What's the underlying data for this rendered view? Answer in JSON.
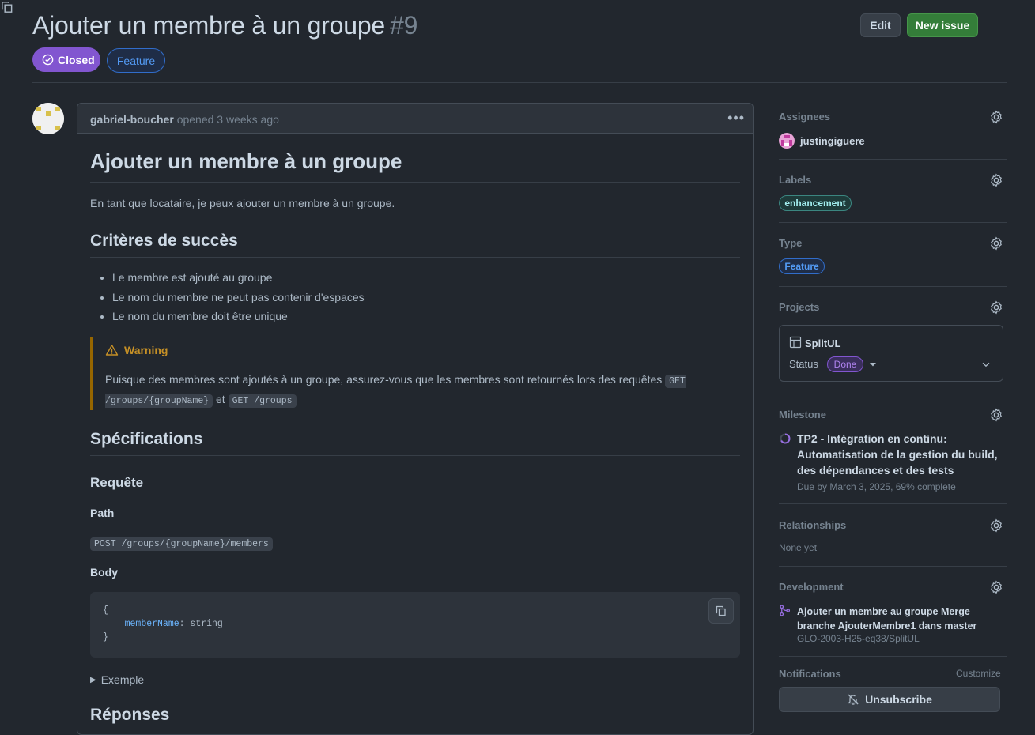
{
  "issue": {
    "title": "Ajouter un membre à un groupe",
    "number": "#9",
    "state": "Closed",
    "type_badge": "Feature"
  },
  "toolbar": {
    "edit_label": "Edit",
    "new_issue_label": "New issue"
  },
  "comment": {
    "author": "gabriel-boucher",
    "opened_text": "opened 3 weeks ago",
    "heading": "Ajouter un membre à un groupe",
    "intro": "En tant que locataire, je peux ajouter un membre à un groupe.",
    "success_heading": "Critères de succès",
    "criteria": [
      "Le membre est ajouté au groupe",
      "Le nom du membre ne peut pas contenir d'espaces",
      "Le nom du membre doit être unique"
    ],
    "warning": {
      "title": "Warning",
      "text_before": "Puisque des membres sont ajoutés à un groupe, assurez-vous que les membres sont retournés lors des requêtes",
      "code1": "GET /groups/{groupName}",
      "between": "et",
      "code2": "GET /groups"
    },
    "spec_heading": "Spécifications",
    "request_heading": "Requête",
    "path_label": "Path",
    "path_code": "POST /groups/{groupName}/members",
    "body_label": "Body",
    "body_code": {
      "open": "{",
      "key": "memberName",
      "value": ": string",
      "close": "}"
    },
    "example_label": "Exemple",
    "responses_heading": "Réponses"
  },
  "sidebar": {
    "assignees_label": "Assignees",
    "assignee": "justingiguere",
    "labels_label": "Labels",
    "label_enhancement": "enhancement",
    "type_label": "Type",
    "type_value": "Feature",
    "projects_label": "Projects",
    "project_name": "SplitUL",
    "project_status_label": "Status",
    "project_status_value": "Done",
    "milestone_label": "Milestone",
    "milestone_title": "TP2 - Intégration en continu: Automatisation de la gestion du build, des dépendances et des tests",
    "milestone_due": "Due by March 3, 2025, 69% complete",
    "relationships_label": "Relationships",
    "relationships_value": "None yet",
    "development_label": "Development",
    "dev_pr_title": "Ajouter un membre au groupe Merge branche AjouterMembre1 dans master",
    "dev_repo": "GLO-2003-H25-eq38/SplitUL",
    "notifications_label": "Notifications",
    "customize_label": "Customize",
    "unsubscribe_label": "Unsubscribe"
  },
  "colors": {
    "background": "#22272e",
    "closed_badge": "#8256d0",
    "new_issue_button": "#347d39",
    "warning_accent": "#c69026",
    "link": "#539bf5"
  }
}
